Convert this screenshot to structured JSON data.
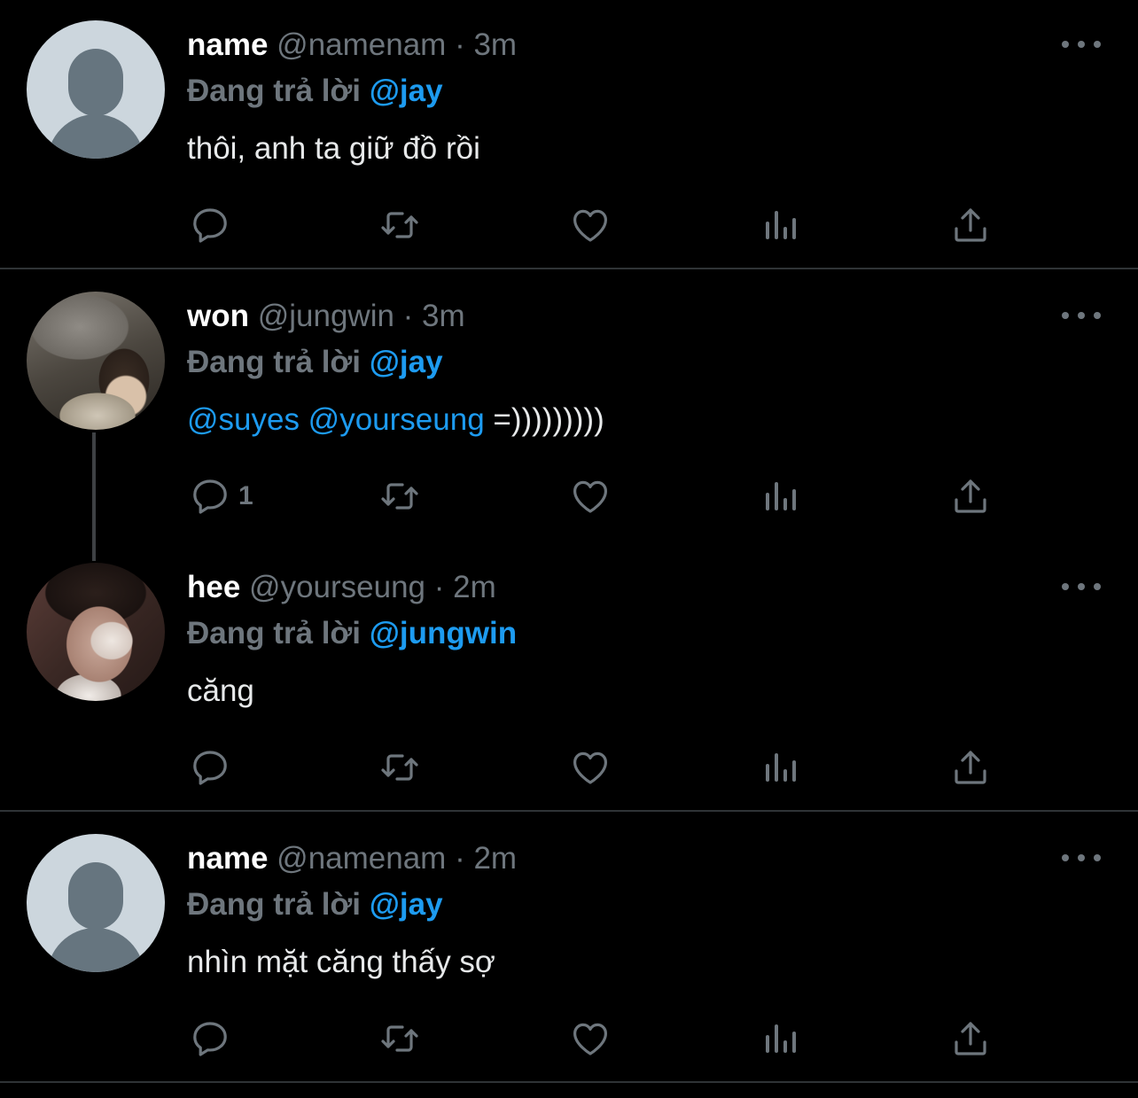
{
  "colors": {
    "background": "#000000",
    "text_primary": "#e7e9ea",
    "text_secondary": "#6e767d",
    "mention": "#1d9bf0",
    "divider": "#2f3336"
  },
  "icons": {
    "reply": "reply-icon",
    "retweet": "retweet-icon",
    "like": "heart-icon",
    "analytics": "analytics-icon",
    "share": "share-icon",
    "more": "more-icon"
  },
  "tweets": [
    {
      "name": "name",
      "handle": "@namenam",
      "time": "· 3m",
      "reply_prefix": "Đang trả lời",
      "reply_to": "@jay",
      "text_mentions": "",
      "text": "thôi, anh ta giữ đồ rồi",
      "reply_count": ""
    },
    {
      "name": "won",
      "handle": "@jungwin",
      "time": "· 3m",
      "reply_prefix": "Đang trả lời",
      "reply_to": "@jay",
      "text_mentions": "@suyes @yourseung",
      "text": "=)))))))))",
      "reply_count": "1"
    },
    {
      "name": "hee",
      "handle": "@yourseung",
      "time": "· 2m",
      "reply_prefix": "Đang trả lời",
      "reply_to": "@jungwin",
      "text_mentions": "",
      "text": "căng",
      "reply_count": ""
    },
    {
      "name": "name",
      "handle": "@namenam",
      "time": "· 2m",
      "reply_prefix": "Đang trả lời",
      "reply_to": "@jay",
      "text_mentions": "",
      "text": "nhìn mặt căng thấy sợ",
      "reply_count": ""
    }
  ]
}
